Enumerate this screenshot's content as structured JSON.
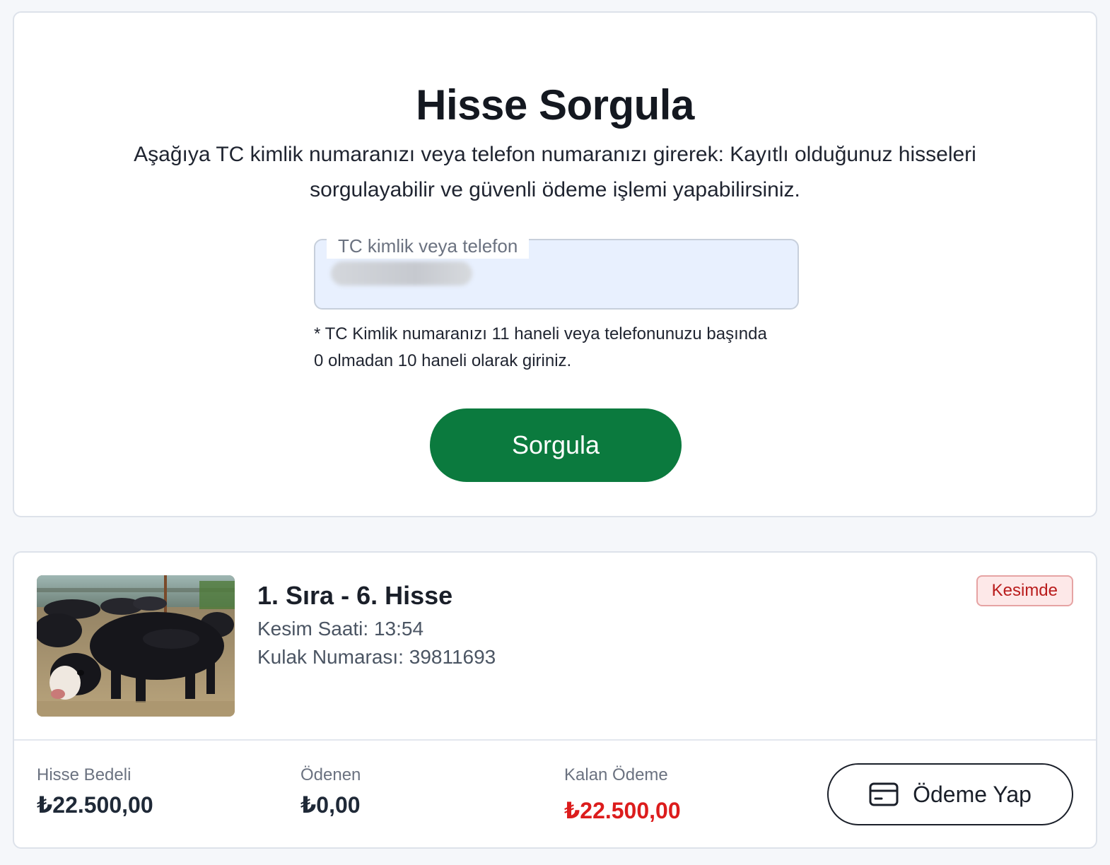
{
  "query": {
    "title": "Hisse Sorgula",
    "description": "Aşağıya TC kimlik numaranızı veya telefon numaranızı girerek: Kayıtlı olduğunuz hisseleri sorgulayabilir ve güvenli ödeme işlemi yapabilirsiniz.",
    "input_label": "TC kimlik veya telefon",
    "input_value": "",
    "hint": "* TC Kimlik numaranızı 11 haneli veya telefonunuzu başında 0 olmadan 10 haneli olarak giriniz.",
    "button_label": "Sorgula"
  },
  "result": {
    "image_icon": "cattle-photo",
    "title": "1. Sıra - 6. Hisse",
    "slaughter_time": "Kesim Saati: 13:54",
    "ear_tag": "Kulak Numarası: 39811693",
    "status": "Kesimde",
    "share_price_label": "Hisse Bedeli",
    "share_price_value": "₺22.500,00",
    "paid_label": "Ödenen",
    "paid_value": "₺0,00",
    "remaining_label": "Kalan Ödeme",
    "remaining_value": "₺22.500,00",
    "pay_button_label": "Ödeme Yap",
    "pay_icon": "credit-card-icon"
  },
  "colors": {
    "primary_green": "#0b7a3e",
    "danger_red": "#dc1c1c",
    "badge_bg": "#fde8e8"
  }
}
